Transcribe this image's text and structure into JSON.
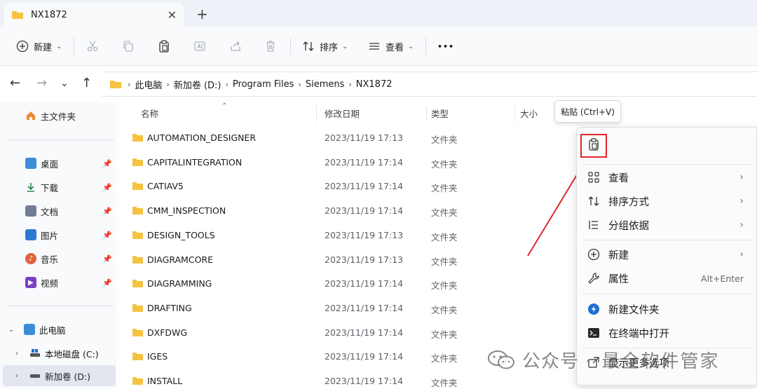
{
  "tab": {
    "title": "NX1872",
    "close_glyph": "✕",
    "new_tab_glyph": "+"
  },
  "toolbar": {
    "new_label": "新建",
    "sort_label": "排序",
    "view_label": "查看",
    "more_glyph": "•••"
  },
  "breadcrumb": [
    "此电脑",
    "新加卷 (D:)",
    "Program Files",
    "Siemens",
    "NX1872"
  ],
  "sidebar": {
    "home": "主文件夹",
    "pinned": [
      {
        "label": "桌面",
        "icon": "desktop-icon",
        "color": "#3b8ed6"
      },
      {
        "label": "下载",
        "icon": "download-icon",
        "color": "#1c8a4a"
      },
      {
        "label": "文档",
        "icon": "document-icon",
        "color": "#6f7e95"
      },
      {
        "label": "图片",
        "icon": "pictures-icon",
        "color": "#2b7ad1"
      },
      {
        "label": "音乐",
        "icon": "music-icon",
        "color": "#e0623a"
      },
      {
        "label": "视频",
        "icon": "video-icon",
        "color": "#7a3fc4"
      }
    ],
    "this_pc": "此电脑",
    "drives": [
      {
        "label": "本地磁盘 (C:)"
      },
      {
        "label": "新加卷 (D:)"
      }
    ]
  },
  "columns": {
    "name": "名称",
    "date": "修改日期",
    "type": "类型",
    "size": "大小"
  },
  "files": [
    {
      "name": "AUTOMATION_DESIGNER",
      "date": "2023/11/19 17:13",
      "type": "文件夹"
    },
    {
      "name": "CAPITALINTEGRATION",
      "date": "2023/11/19 17:14",
      "type": "文件夹"
    },
    {
      "name": "CATIAV5",
      "date": "2023/11/19 17:14",
      "type": "文件夹"
    },
    {
      "name": "CMM_INSPECTION",
      "date": "2023/11/19 17:14",
      "type": "文件夹"
    },
    {
      "name": "DESIGN_TOOLS",
      "date": "2023/11/19 17:13",
      "type": "文件夹"
    },
    {
      "name": "DIAGRAMCORE",
      "date": "2023/11/19 17:13",
      "type": "文件夹"
    },
    {
      "name": "DIAGRAMMING",
      "date": "2023/11/19 17:14",
      "type": "文件夹"
    },
    {
      "name": "DRAFTING",
      "date": "2023/11/19 17:14",
      "type": "文件夹"
    },
    {
      "name": "DXFDWG",
      "date": "2023/11/19 17:14",
      "type": "文件夹"
    },
    {
      "name": "IGES",
      "date": "2023/11/19 17:14",
      "type": "文件夹"
    },
    {
      "name": "INSTALL",
      "date": "2023/11/19 17:14",
      "type": "文件夹"
    }
  ],
  "tooltip": "粘贴 (Ctrl+V)",
  "context_menu": {
    "view": "查看",
    "sort_by": "排序方式",
    "group_by": "分组依据",
    "new": "新建",
    "properties": "属性",
    "properties_shortcut": "Alt+Enter",
    "new_folder": "新建文件夹",
    "open_terminal": "在终端中打开",
    "more_options": "显示更多选项"
  },
  "watermark": {
    "text": "公众号 ·",
    "brand": "最全软件管家"
  },
  "colors": {
    "folder": "#f5c242",
    "highlight_red": "#e0262b",
    "accent": "#1f6fd1"
  }
}
